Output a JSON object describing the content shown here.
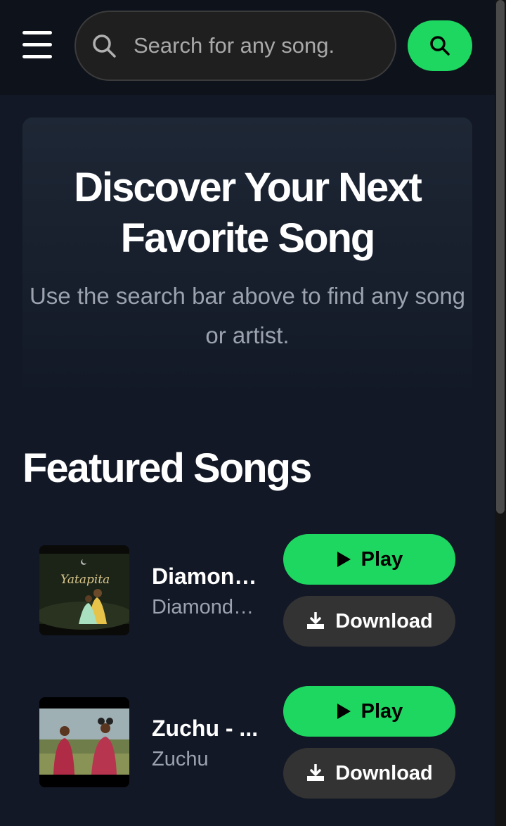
{
  "header": {
    "menu_icon": "hamburger-menu-icon",
    "search": {
      "placeholder": "Search for any song.",
      "value": ""
    },
    "search_button_icon": "search-icon"
  },
  "hero": {
    "title": "Discover Your Next Favorite Song",
    "subtitle": "Use the search bar above to find any song or artist."
  },
  "featured": {
    "title": "Featured Songs",
    "songs": [
      {
        "title": "Diamond Platnumz - Yatapita",
        "artist": "Diamond Platnumz",
        "play_label": "Play",
        "download_label": "Download",
        "cover_text": "Yatapita"
      },
      {
        "title": "Zuchu - ...",
        "artist": "Zuchu",
        "play_label": "Play",
        "download_label": "Download"
      }
    ]
  },
  "colors": {
    "accent": "#1ed760",
    "background": "#121826",
    "header": "#0d121b",
    "secondary_button": "#333333",
    "muted_text": "#9ca3af"
  }
}
